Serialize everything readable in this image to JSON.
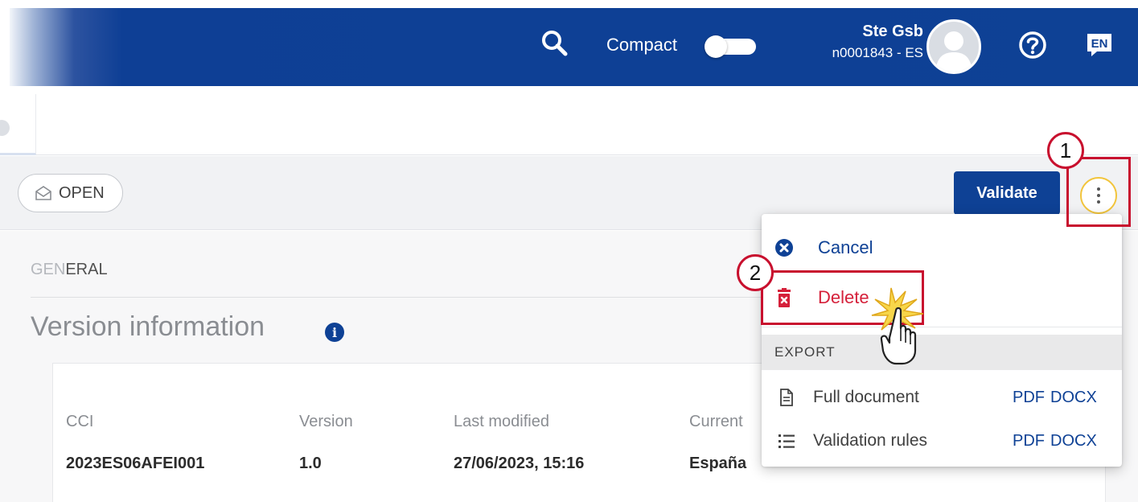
{
  "header": {
    "compact_label": "Compact",
    "user_name": "Ste Gsb",
    "user_id": "n0001843 - ES",
    "language": "EN",
    "icons": [
      "search-icon",
      "toggle-switch",
      "avatar",
      "help-icon",
      "language-icon"
    ]
  },
  "toolbar": {
    "status_badge": "OPEN",
    "validate_label": "Validate",
    "more_icon": "kebab-icon"
  },
  "main": {
    "section_label_prefix": "GEN",
    "section_label_rest": "ERAL",
    "version_title": "Version information",
    "info_icon": "i",
    "columns": [
      {
        "label": "CCI",
        "value": "2023ES06AFEI001"
      },
      {
        "label": "Version",
        "value": "1.0"
      },
      {
        "label": "Last modified",
        "value": "27/06/2023, 15:16"
      },
      {
        "label": "Current",
        "value": "España"
      }
    ]
  },
  "menu": {
    "cancel_label": "Cancel",
    "delete_label": "Delete",
    "export_heading": "EXPORT",
    "rows": [
      {
        "label": "Full document",
        "pdf": "PDF",
        "docx": "DOCX"
      },
      {
        "label": "Validation rules",
        "pdf": "PDF",
        "docx": "DOCX"
      }
    ]
  },
  "annotations": {
    "step1": "1",
    "step2": "2"
  },
  "colors": {
    "primary": "#0e4195",
    "danger": "#d5203a",
    "annotation": "#c8102e",
    "highlight": "#f2c53d"
  }
}
